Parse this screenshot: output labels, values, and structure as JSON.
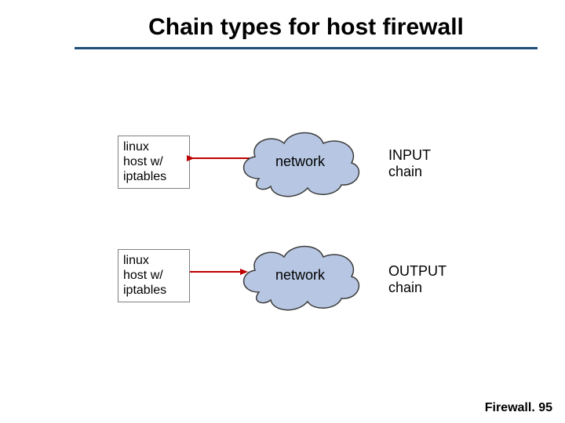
{
  "slide": {
    "title": "Chain types for host firewall"
  },
  "rows": [
    {
      "host_label": "linux\nhost w/\niptables",
      "cloud_label": "network",
      "chain_label": "INPUT\nchain",
      "arrow_dir": "left"
    },
    {
      "host_label": "linux\nhost w/\niptables",
      "cloud_label": "network",
      "chain_label": "OUTPUT\nchain",
      "arrow_dir": "right"
    }
  ],
  "colors": {
    "cloud_fill": "#b7c7e3",
    "cloud_stroke": "#3c3c3c",
    "arrow": "#c00000",
    "rule": "#1f4e79"
  },
  "footer": {
    "text_prefix": "Firewall. ",
    "number": 95
  }
}
